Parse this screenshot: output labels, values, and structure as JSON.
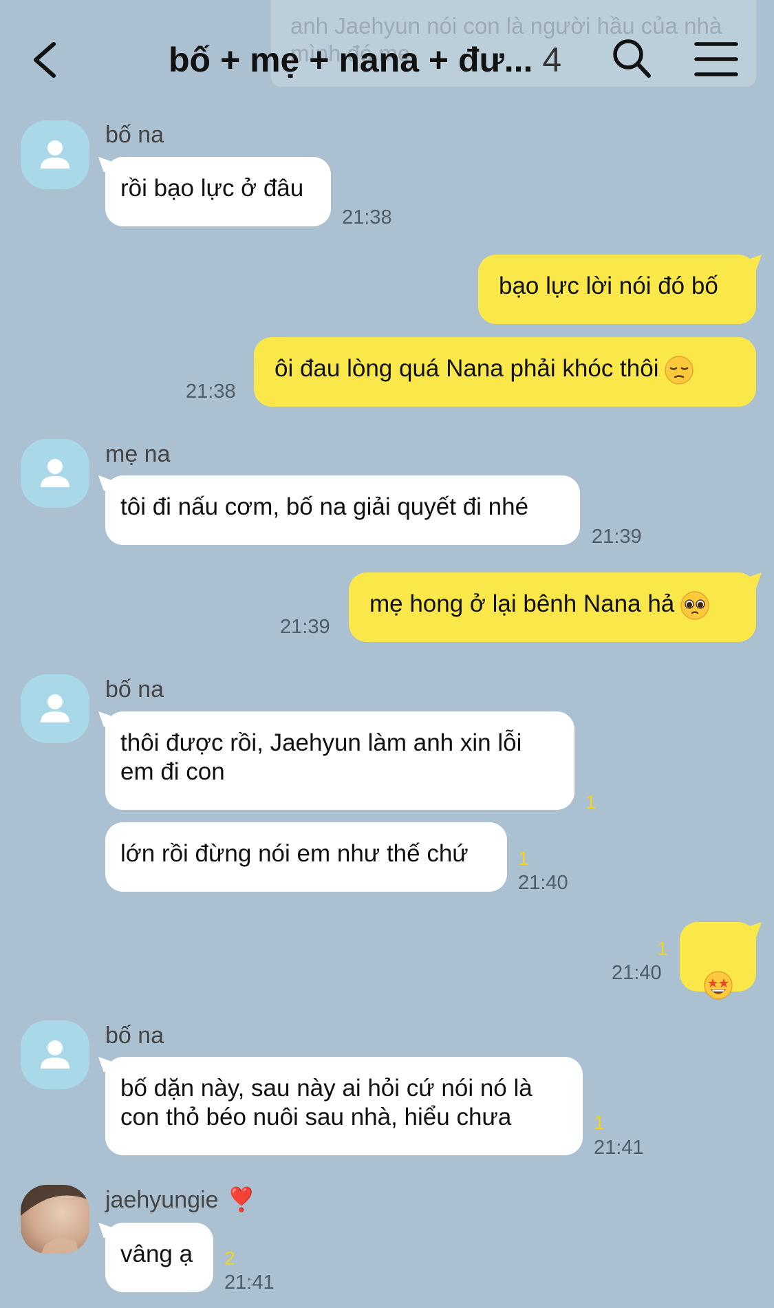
{
  "header": {
    "back_label": "<",
    "title": "bố + mẹ + nana + đư...",
    "member_count": "4",
    "ghost_notice": "anh Jaehyun nói con là người hầu của nhà mình đó mẹ"
  },
  "messages": [
    {
      "sender": "bố na",
      "text": "rồi bạo lực ở đâu",
      "time": "21:38"
    },
    {
      "text": "bạo lực lời nói đó bố"
    },
    {
      "text": "ôi đau lòng quá Nana phải khóc thôi",
      "emoji": "pensive-face-emoji",
      "time": "21:38"
    },
    {
      "sender": "mẹ na",
      "text": "tôi đi nấu cơm, bố na giải quyết đi nhé",
      "time": "21:39"
    },
    {
      "text": "mẹ hong ở lại bênh Nana hả",
      "emoji": "pleading-face-emoji",
      "time": "21:39"
    },
    {
      "sender": "bố na",
      "text": "thôi được rồi, Jaehyun làm anh xin lỗi\nem đi con",
      "unread": "1"
    },
    {
      "text": "lớn rồi đừng nói em như thế chứ",
      "unread": "1",
      "time": "21:40"
    },
    {
      "emoji": "star-struck-emoji",
      "unread": "1",
      "time": "21:40"
    },
    {
      "sender": "bố na",
      "text": "bố dặn này, sau này ai hỏi cứ nói nó là\ncon thỏ béo nuôi sau nhà, hiểu chưa",
      "unread": "1",
      "time": "21:41"
    },
    {
      "sender": "jaehyungie",
      "sender_badge": "❣️",
      "text": "vâng ạ",
      "unread": "2",
      "time": "21:41"
    }
  ],
  "icons": {
    "back": "chevron-left-icon",
    "search": "search-icon",
    "menu": "hamburger-menu-icon",
    "avatar": "default-person-icon"
  },
  "colors": {
    "background": "#abc1d1",
    "outgoing_bubble": "#fae84b",
    "incoming_bubble": "#ffffff",
    "unread_count": "#f2d21c",
    "avatar_placeholder": "#a9d8e8"
  }
}
